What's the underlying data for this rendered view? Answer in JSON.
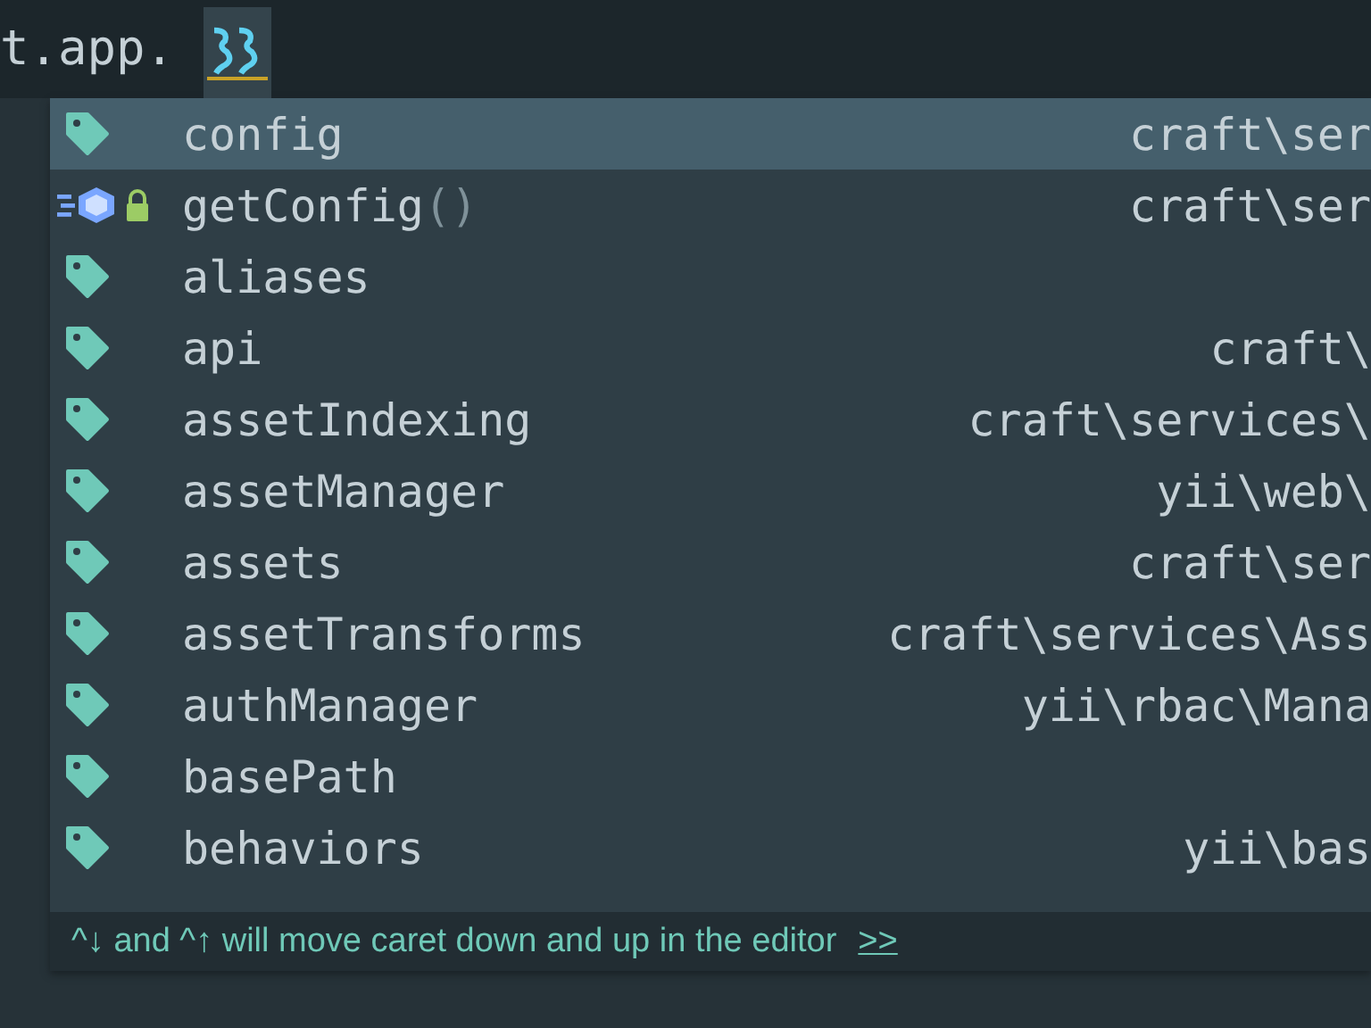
{
  "editor": {
    "code": "t.app."
  },
  "completion": {
    "items": [
      {
        "kind": "property",
        "name": "config",
        "type": "craft\\ser",
        "locked": false,
        "selected": true
      },
      {
        "kind": "method",
        "name": "getConfig",
        "params": "()",
        "type": "craft\\ser",
        "locked": true,
        "selected": false
      },
      {
        "kind": "property",
        "name": "aliases",
        "locked": false,
        "selected": false
      },
      {
        "kind": "property",
        "name": "api",
        "type": "craft\\",
        "locked": false,
        "selected": false
      },
      {
        "kind": "property",
        "name": "assetIndexing",
        "type": "craft\\services\\",
        "locked": false,
        "selected": false
      },
      {
        "kind": "property",
        "name": "assetManager",
        "type": "yii\\web\\",
        "locked": false,
        "selected": false
      },
      {
        "kind": "property",
        "name": "assets",
        "type": "craft\\ser",
        "locked": false,
        "selected": false
      },
      {
        "kind": "property",
        "name": "assetTransforms",
        "type": "craft\\services\\Ass",
        "locked": false,
        "selected": false
      },
      {
        "kind": "property",
        "name": "authManager",
        "type": "yii\\rbac\\Mana",
        "locked": false,
        "selected": false
      },
      {
        "kind": "property",
        "name": "basePath",
        "locked": false,
        "selected": false
      },
      {
        "kind": "property",
        "name": "behaviors",
        "type": "yii\\bas",
        "locked": false,
        "selected": false
      }
    ],
    "hint": {
      "text": "^↓ and ^↑ will move caret down and up in the editor",
      "link": ">>"
    }
  }
}
